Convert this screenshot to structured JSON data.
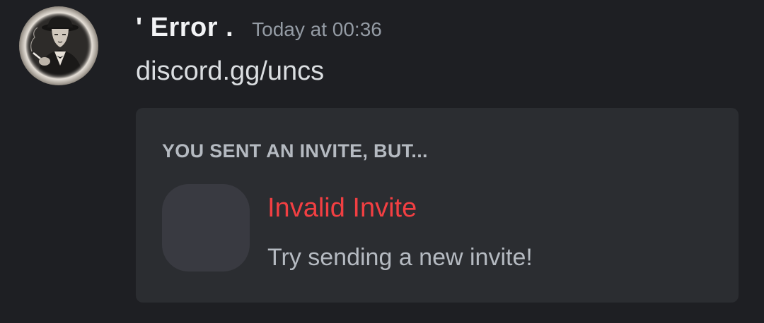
{
  "message": {
    "author": {
      "username": "' Error .",
      "avatar_icon": "user-avatar-image"
    },
    "timestamp": "Today at 00:36",
    "content": "discord.gg/uncs"
  },
  "invite_embed": {
    "header": "YOU SENT AN INVITE, BUT...",
    "guild_icon": "guild-icon-placeholder",
    "title": "Invalid Invite",
    "subtitle": "Try sending a new invite!"
  },
  "colors": {
    "background": "#1e1f23",
    "embed_background": "#2b2d31",
    "username": "#f2f3f5",
    "timestamp": "#949ba4",
    "message_text": "#dbdee1",
    "invalid_red": "#f23f42",
    "muted_text": "#b5bac1"
  }
}
